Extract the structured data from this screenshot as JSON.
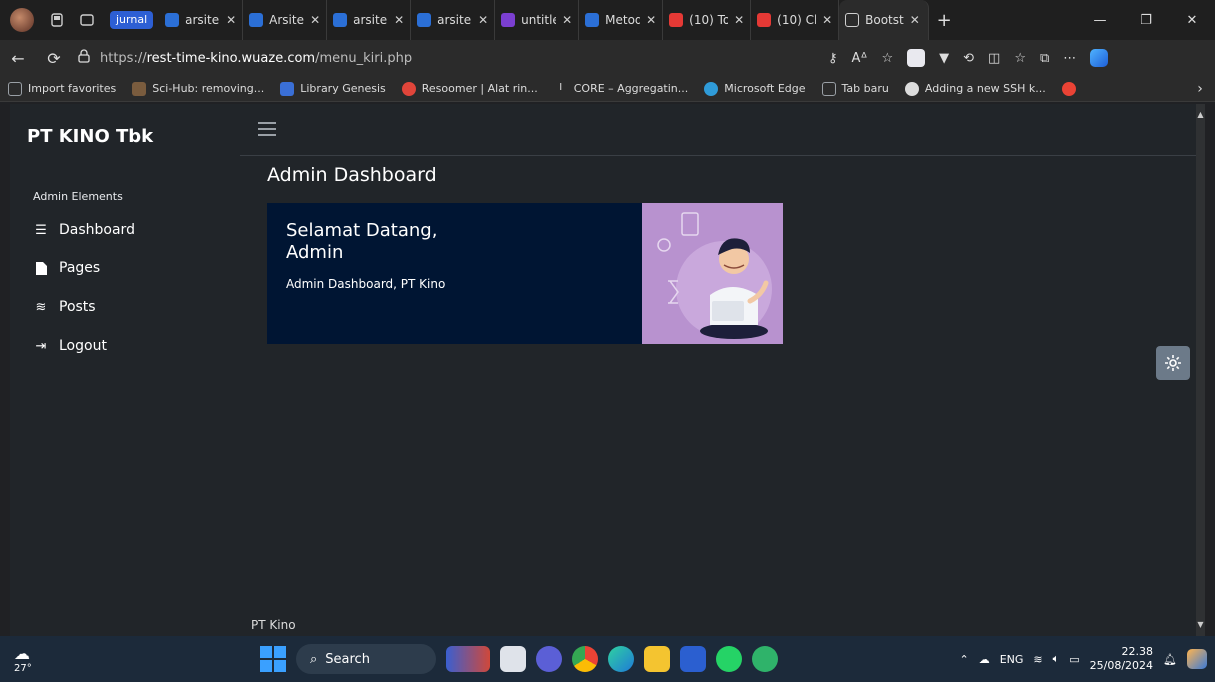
{
  "browser": {
    "tab_group_label": "jurnal",
    "tabs": [
      {
        "title": "arsitek",
        "color": "#2b6fd6"
      },
      {
        "title": "Arsitek",
        "color": "#2b6fd6"
      },
      {
        "title": "arsitek",
        "color": "#2b6fd6"
      },
      {
        "title": "arsitek",
        "color": "#2b6fd6"
      },
      {
        "title": "untitle",
        "color": "#7b3fd1"
      },
      {
        "title": "Metod",
        "color": "#2b6fd6"
      },
      {
        "title": "(10) To",
        "color": "#e53935"
      },
      {
        "title": "(10) Cl",
        "color": "#e53935"
      },
      {
        "title": "Bootst",
        "color": "#9e9e9e",
        "active": true
      }
    ],
    "url_prefix": "https://",
    "url_host": "rest-time-kino.wuaze.com",
    "url_path": "/menu_kiri.php",
    "favorites": [
      {
        "label": "Import favorites",
        "color": "#9aa0a6"
      },
      {
        "label": "Sci-Hub: removing...",
        "color": "#7a5c3e"
      },
      {
        "label": "Library Genesis",
        "color": "#3a6fd6"
      },
      {
        "label": "Resoomer | Alat rin...",
        "color": "#e0453a"
      },
      {
        "label": "CORE – Aggregatin...",
        "color": "#dcdcdc"
      },
      {
        "label": "Microsoft Edge",
        "color": "#2f9bd8"
      },
      {
        "label": "Tab baru",
        "color": "#9aa0a6"
      },
      {
        "label": "Adding a new SSH k...",
        "color": "#dcdcdc"
      },
      {
        "label": "",
        "color": "#ea4335"
      }
    ]
  },
  "app": {
    "brand": "PT KINO Tbk",
    "sidebar_heading": "Admin Elements",
    "menu": [
      {
        "label": "Dashboard",
        "icon": "list-icon"
      },
      {
        "label": "Pages",
        "icon": "file-icon"
      },
      {
        "label": "Posts",
        "icon": "sliders-icon"
      },
      {
        "label": "Logout",
        "icon": "logout-icon"
      }
    ],
    "page_title": "Admin Dashboard",
    "welcome_title": "Selamat Datang, Admin",
    "welcome_subtitle": "Admin Dashboard, PT Kino",
    "footer": "PT Kino"
  },
  "taskbar": {
    "temperature": "27°",
    "search_placeholder": "Search",
    "language": "ENG",
    "time": "22.38",
    "date": "25/08/2024"
  },
  "colors": {
    "card_bg": "#001533",
    "illustration_bg": "#b892cf",
    "page_bg": "#212529"
  }
}
